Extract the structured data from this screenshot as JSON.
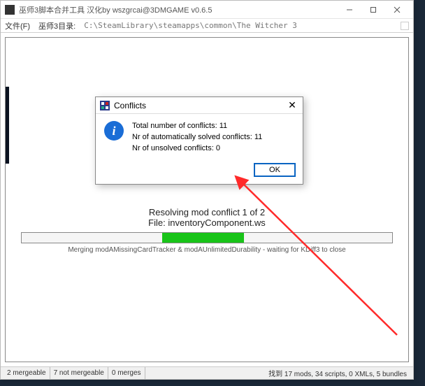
{
  "window": {
    "title": "巫师3脚本合并工具 汉化by wszgrcai@3DMGAME v0.6.5"
  },
  "menubar": {
    "file": "文件(F)",
    "dirlabel": "巫师3目录:",
    "path": "C:\\SteamLibrary\\steamapps\\common\\The Witcher 3"
  },
  "progress": {
    "line1": "Resolving mod conflict 1 of 2",
    "line2": "File: inventoryComponent.ws",
    "merge": "Merging modAMissingCardTracker & modAUnlimitedDurability - waiting for KDiff3 to close"
  },
  "dialog": {
    "title": "Conflicts",
    "line1": "Total number of conflicts: 11",
    "line2": "Nr of automatically solved conflicts: 11",
    "line3": "Nr of unsolved conflicts: 0",
    "ok": "OK"
  },
  "status": {
    "left1": "2 mergeable",
    "left2": "7 not mergeable",
    "left3": "0 merges",
    "right": "找到 17 mods, 34 scripts, 0 XMLs, 5 bundles"
  }
}
